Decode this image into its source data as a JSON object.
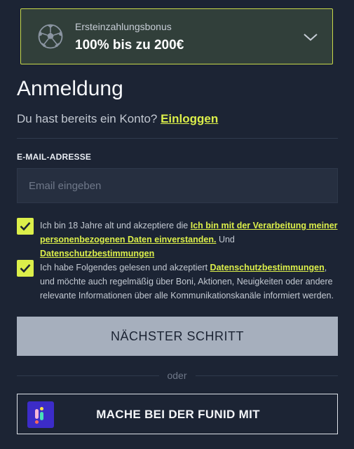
{
  "bonus": {
    "subtitle": "Ersteinzahlungsbonus",
    "amount": "100% bis zu 200€",
    "icon": "soccer-ball-icon",
    "expand_icon": "chevron-down-icon"
  },
  "form": {
    "title": "Anmeldung",
    "account_prompt": "Du hast bereits ein Konto?",
    "login_link": "Einloggen",
    "email_label": "E-MAIL-ADRESSE",
    "email_placeholder": "Email eingeben",
    "email_value": ""
  },
  "consents": [
    {
      "checked": true,
      "text_before": "Ich bin 18 Jahre alt und akzeptiere die",
      "link1": "Ich bin mit der Verarbeitung meiner personenbezogenen Daten einverstanden.",
      "text_middle": "Und",
      "link2": "Datenschutzbestimmungen"
    },
    {
      "checked": true,
      "text_before": "Ich habe Folgendes gelesen und akzeptiert",
      "link1": "Datenschutzbestimmungen",
      "text_after": ", und möchte auch regelmäßig über Boni, Aktionen, Neuigkeiten oder andere relevante Informationen über alle Kommunikationskanäle informiert werden."
    }
  ],
  "actions": {
    "next_label": "NÄCHSTER SCHRITT",
    "separator": "oder",
    "funid_label": "MACHE BEI DER FUNID MIT"
  },
  "colors": {
    "background": "#1c2434",
    "accent": "#dcef4a",
    "bonus_bg": "#313f3a",
    "button_disabled": "#a6afbd",
    "funid_brand": "#3c2cc8"
  }
}
